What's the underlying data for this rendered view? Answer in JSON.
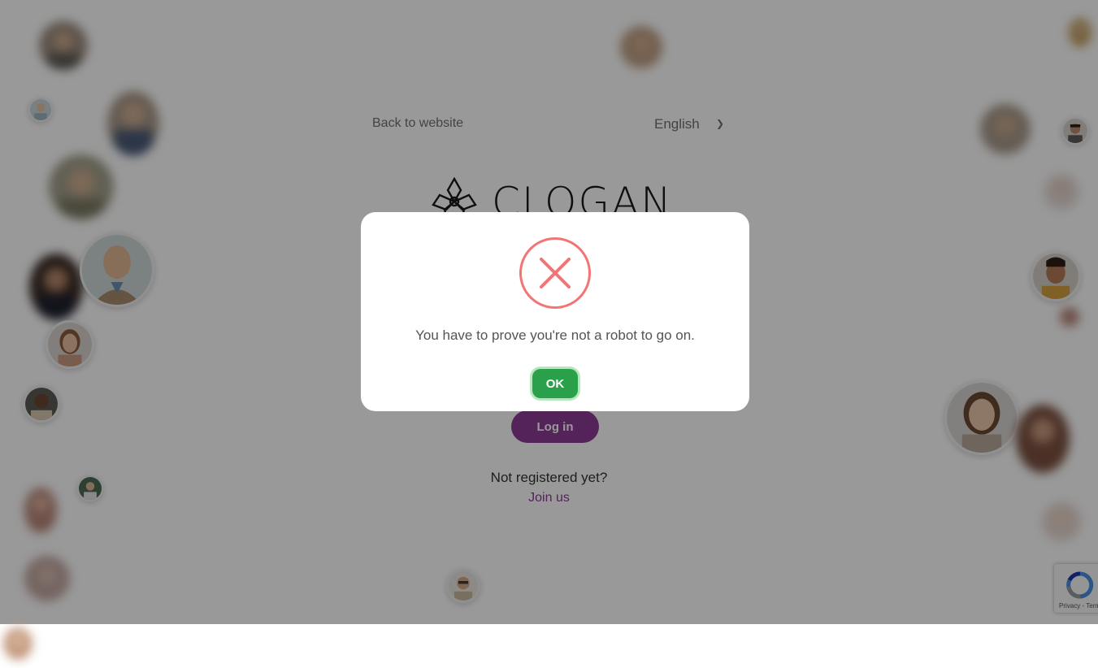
{
  "header": {
    "back_link": "Back to website",
    "language": "English"
  },
  "brand": {
    "logo_text": "CLOGAN"
  },
  "login": {
    "login_button": "Log in",
    "not_registered": "Not registered yet?",
    "join_link": "Join us"
  },
  "alert": {
    "message": "You have to prove you're not a robot to go on.",
    "ok_button": "OK",
    "icon": "error-x-icon"
  },
  "recaptcha": {
    "label": "Privacy - Terms"
  },
  "colors": {
    "accent": "#8d3b94",
    "error": "#f27474",
    "ok": "#2aa04a"
  }
}
